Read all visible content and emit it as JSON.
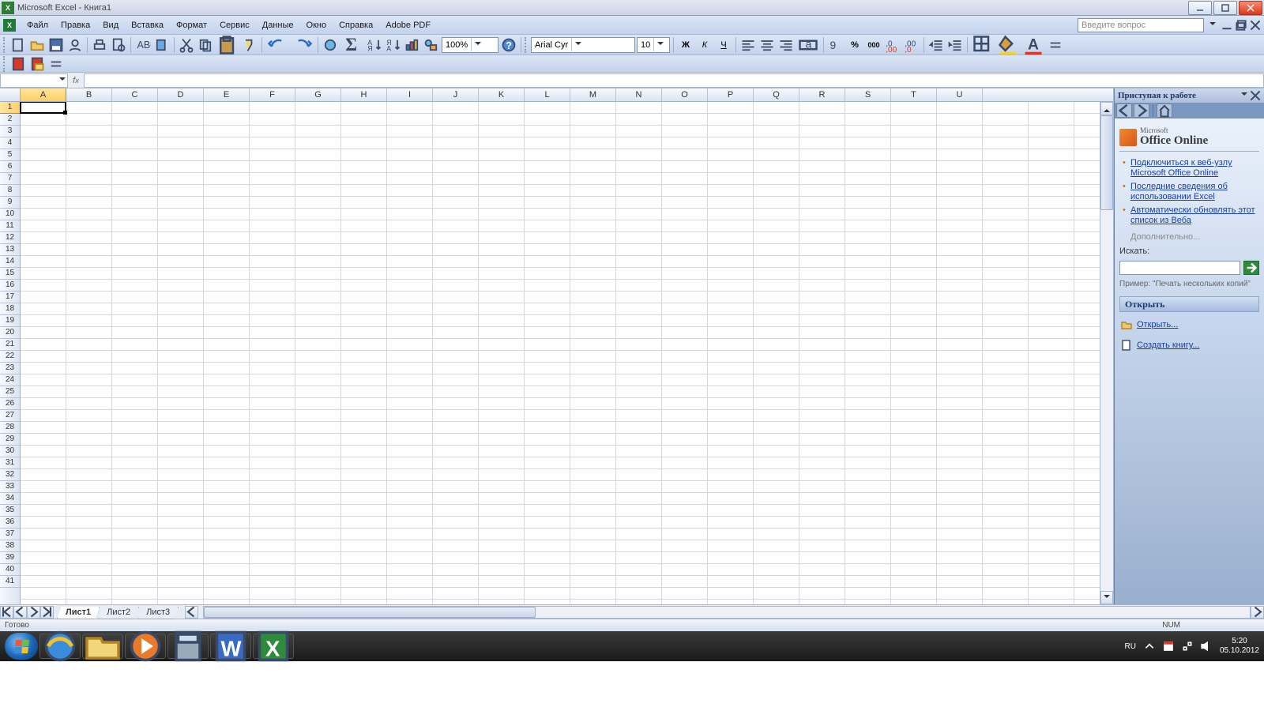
{
  "title": "Microsoft Excel - Книга1",
  "menus": [
    "Файл",
    "Правка",
    "Вид",
    "Вставка",
    "Формат",
    "Сервис",
    "Данные",
    "Окно",
    "Справка",
    "Adobe PDF"
  ],
  "question_placeholder": "Введите вопрос",
  "zoom": "100%",
  "font_name": "Arial Cyr",
  "font_size": "10",
  "name_box": "",
  "formula_bar": "",
  "columns": [
    "A",
    "B",
    "C",
    "D",
    "E",
    "F",
    "G",
    "H",
    "I",
    "J",
    "K",
    "L",
    "M",
    "N",
    "O",
    "P",
    "Q",
    "R",
    "S",
    "T",
    "U"
  ],
  "row_count": 41,
  "selected_cell": "A1",
  "sheet_tabs": [
    "Лист1",
    "Лист2",
    "Лист3"
  ],
  "active_tab": 0,
  "status_ready": "Готово",
  "status_num": "NUM",
  "taskpane": {
    "title": "Приступая к работе",
    "office_small": "Microsoft",
    "office_big": "Office Online",
    "links": [
      "Подключиться к веб-узлу Microsoft Office Online",
      "Последние сведения об использовании Excel",
      "Автоматически обновлять этот список из Веба"
    ],
    "more": "Дополнительно...",
    "search_label": "Искать:",
    "example": "Пример:  \"Печать нескольких копий\"",
    "open_header": "Открыть",
    "open_link": "Открыть...",
    "new_link": "Создать книгу..."
  },
  "system": {
    "lang": "RU",
    "time": "5:20",
    "date": "05.10.2012"
  }
}
